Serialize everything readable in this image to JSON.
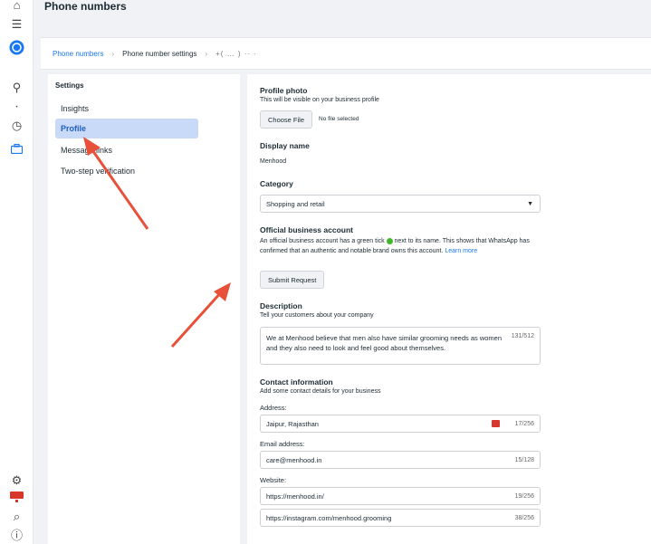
{
  "header": {
    "title": "Phone numbers"
  },
  "breadcrumb": {
    "items": [
      "Phone numbers",
      "Phone number settings"
    ],
    "phone": "+( … ) ·· ·"
  },
  "settings": {
    "heading": "Settings",
    "items": [
      {
        "label": "Insights",
        "active": false
      },
      {
        "label": "Profile",
        "active": true
      },
      {
        "label": "Message links",
        "active": false
      },
      {
        "label": "Two-step verification",
        "active": false
      }
    ]
  },
  "profile": {
    "photo_title": "Profile photo",
    "photo_desc": "This will be visible on your business profile",
    "choose_file": "Choose File",
    "no_file": "No file selected",
    "display_name_title": "Display name",
    "display_name": "Menhood",
    "category_title": "Category",
    "category_value": "Shopping and retail",
    "official_title": "Official business account",
    "official_desc_1": "An official business account has a green tick",
    "official_desc_2": "next to its name. This shows that",
    "official_desc_3": "WhatsApp has confirmed that an authentic and notable brand owns this account.",
    "learn": "Learn",
    "more": "more",
    "submit": "Submit Request",
    "description_title": "Description",
    "description_desc": "Tell your customers about your company",
    "description_value": "We at Menhood believe that men also have similar grooming needs as women and they also need to look and feel good about themselves.",
    "description_count": "131/512",
    "contact_title": "Contact information",
    "contact_desc": "Add some contact details for your business",
    "address_label": "Address:",
    "address_value": "Jaipur, Rajasthan",
    "address_count": "17/256",
    "email_label": "Email address:",
    "email_value": "care@menhood.in",
    "email_count": "15/128",
    "website_label": "Website:",
    "website_1": "https://menhood.in/",
    "website_1_count": "19/256",
    "website_2": "https://instagram.com/menhood.grooming",
    "website_2_count": "38/256"
  },
  "colors": {
    "accent": "#1877f2",
    "active_bg": "#c9daf8",
    "arrow": "#e8503a",
    "tick": "#42b72a"
  }
}
